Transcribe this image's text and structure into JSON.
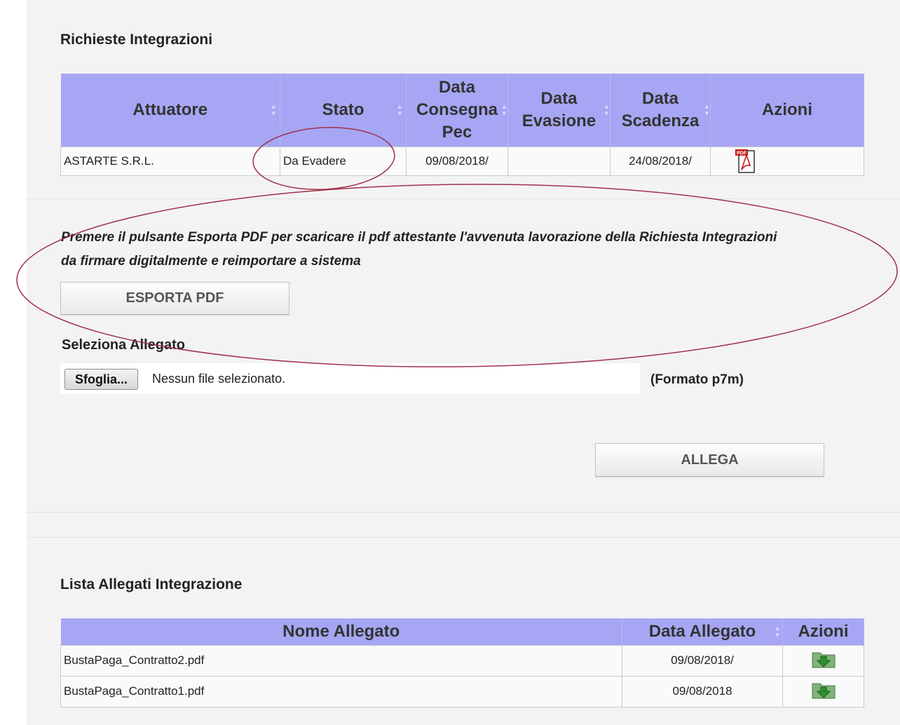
{
  "requests": {
    "title": "Richieste Integrazioni",
    "columns": [
      "Attuatore",
      "Stato",
      "Data Consegna Pec",
      "Data Evasione",
      "Data Scadenza",
      "Azioni"
    ],
    "column_lines": {
      "consegna": [
        "Data",
        "Consegna",
        "Pec"
      ],
      "evasione": [
        "Data",
        "Evasione"
      ],
      "scadenza": [
        "Data",
        "Scadenza"
      ]
    },
    "rows": [
      {
        "attuatore": "ASTARTE S.R.L.",
        "stato": "Da Evadere",
        "data_consegna": "09/08/2018/",
        "data_evasione": "",
        "data_scadenza": "24/08/2018/",
        "action_icon": "pdf-icon"
      }
    ]
  },
  "export": {
    "instruction_line1": "Premere il pulsante Esporta PDF per scaricare il pdf attestante l'avvenuta lavorazione della Richiesta Integrazioni",
    "instruction_line2": "da firmare digitalmente e reimportare a sistema",
    "button_label": "ESPORTA PDF"
  },
  "attachment": {
    "label": "Seleziona Allegato",
    "browse_label": "Sfoglia...",
    "file_status": "Nessun file selezionato.",
    "format_hint": "(Formato p7m)",
    "attach_button": "ALLEGA"
  },
  "attachments_list": {
    "title": "Lista Allegati Integrazione",
    "columns": [
      "Nome Allegato",
      "Data Allegato",
      "Azioni"
    ],
    "rows": [
      {
        "name": "BustaPaga_Contratto2.pdf",
        "date": "09/08/2018/",
        "action_icon": "download-icon"
      },
      {
        "name": "BustaPaga_Contratto1.pdf",
        "date": "09/08/2018",
        "action_icon": "download-icon"
      }
    ]
  },
  "colors": {
    "header_bg": "#a6a6f4",
    "panel_bg": "#f3f3f3",
    "annotation_ellipse": "#a0304a"
  }
}
